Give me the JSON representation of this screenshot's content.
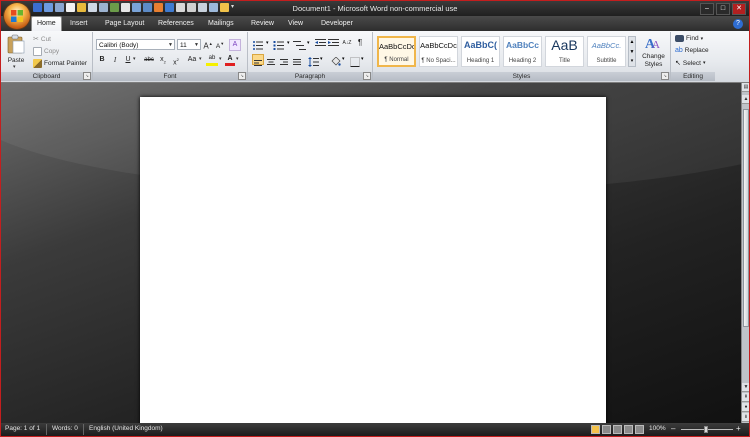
{
  "window": {
    "title": "Document1 - Microsoft Word non-commercial use",
    "controls": [
      "–",
      "□",
      "✕"
    ]
  },
  "tabs": [
    "Home",
    "Insert",
    "Page Layout",
    "References",
    "Mailings",
    "Review",
    "View",
    "Developer"
  ],
  "help_glyph": "?",
  "clipboard": {
    "paste": "Paste",
    "cut": "Cut",
    "copy": "Copy",
    "format_painter": "Format Painter",
    "label": "Clipboard"
  },
  "font": {
    "name": "Calibri (Body)",
    "size": "11",
    "grow": "A",
    "shrink": "A",
    "clear": "A",
    "bold": "B",
    "italic": "I",
    "underline": "U",
    "strike": "abc",
    "subscript": "x",
    "superscript": "x",
    "change_case": "Aa",
    "highlight": "ab",
    "font_color": "A",
    "label": "Font"
  },
  "paragraph": {
    "sort": "A↓Z",
    "pilcrow": "¶",
    "label": "Paragraph"
  },
  "styles": {
    "items": [
      {
        "preview": "AaBbCcDc",
        "name": "¶ Normal"
      },
      {
        "preview": "AaBbCcDc",
        "name": "¶ No Spaci..."
      },
      {
        "preview": "AaBbC(",
        "name": "Heading 1"
      },
      {
        "preview": "AaBbCc",
        "name": "Heading 2"
      },
      {
        "preview": "AaB",
        "name": "Title"
      },
      {
        "preview": "AaBbCc.",
        "name": "Subtitle"
      }
    ],
    "change_styles": "Change Styles",
    "label": "Styles"
  },
  "editing": {
    "find": "Find",
    "replace": "Replace",
    "select": "Select",
    "label": "Editing"
  },
  "status": {
    "page": "Page: 1 of 1",
    "words": "Words: 0",
    "language": "English (United Kingdom)",
    "zoom": "100%",
    "zoom_minus": "–",
    "zoom_plus": "+"
  },
  "colors": {
    "accent_selected_style": "#f0b64a",
    "help": "#2e6dd2",
    "font_color_bar": "#e02020",
    "highlight_bar": "#f5f000",
    "heading_blue": "#2e5d9f"
  }
}
